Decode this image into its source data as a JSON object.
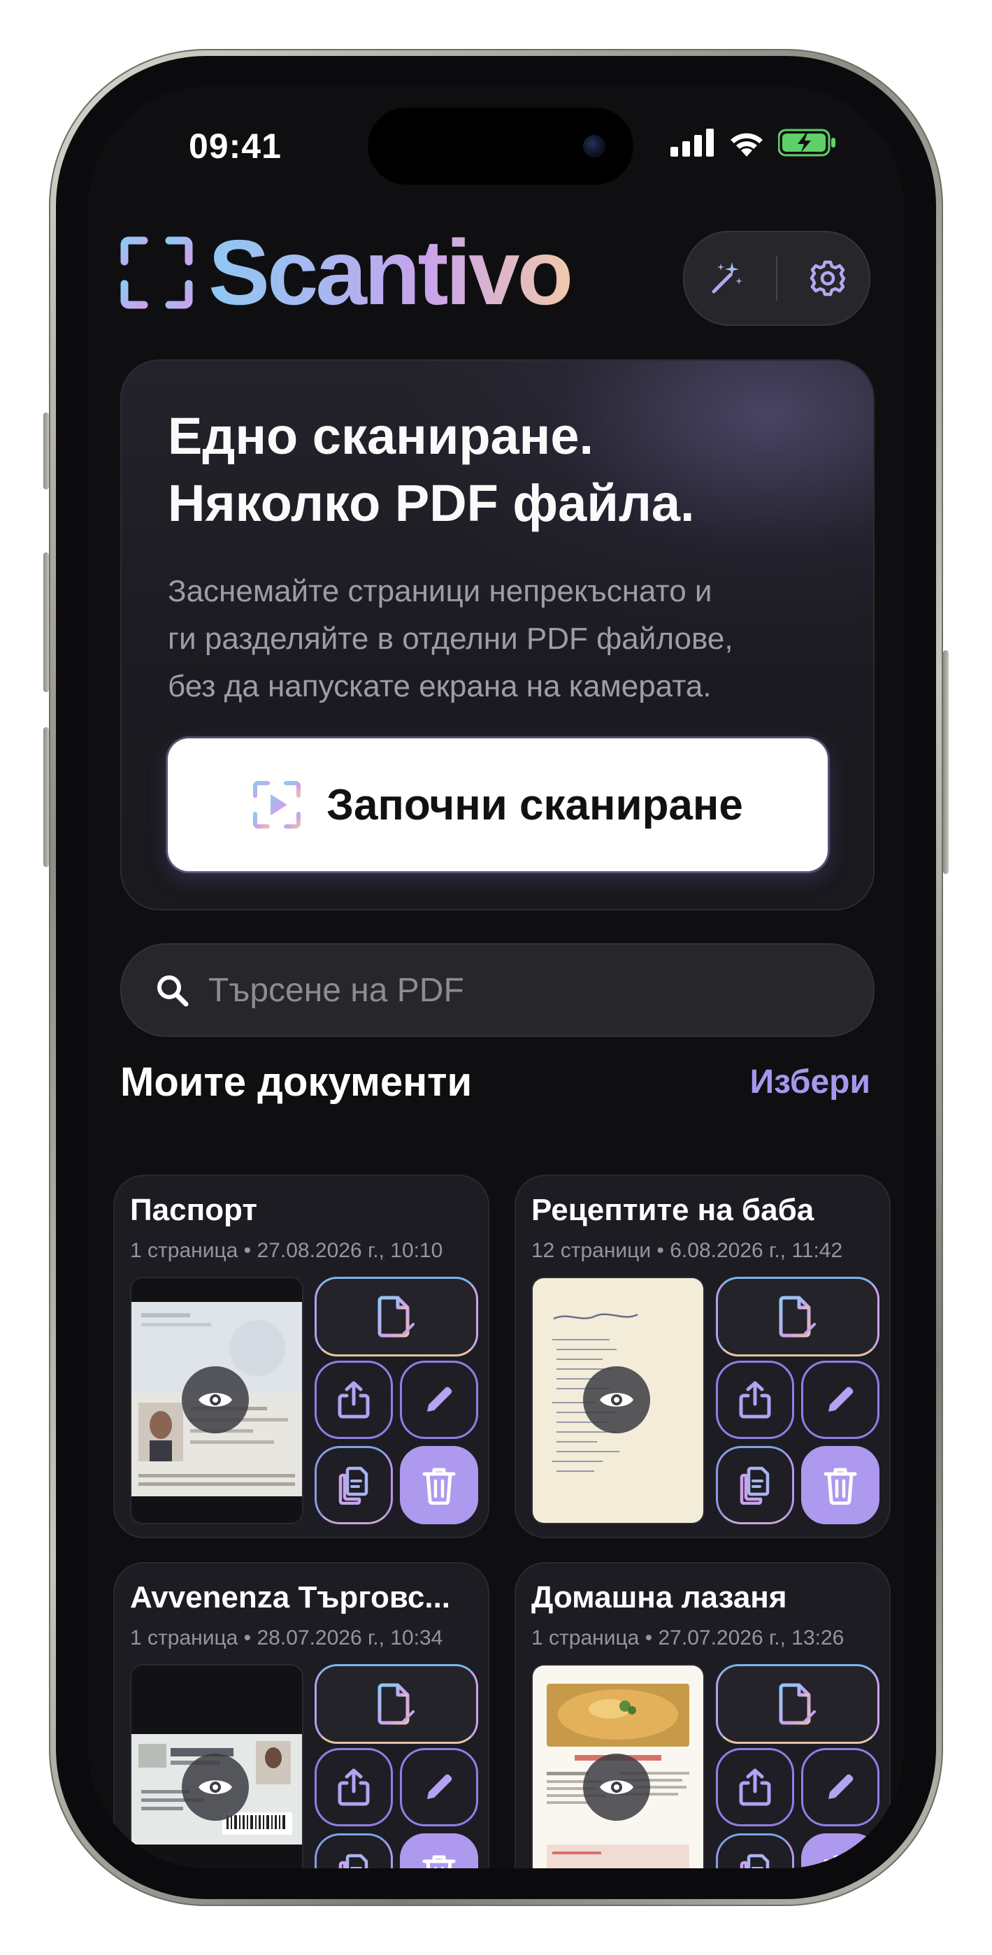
{
  "status_bar": {
    "time": "09:41"
  },
  "app": {
    "name": "Scantivo"
  },
  "hero": {
    "title_lines": [
      "Едно сканиране.",
      "Няколко PDF файла."
    ],
    "description_lines": [
      "Заснемайте страници непрекъснато и",
      "ги разделяйте в отделни PDF файлове,",
      "без да напускате екрана на камерата."
    ],
    "start_button_label": "Започни сканиране"
  },
  "search": {
    "placeholder": "Търсене на PDF"
  },
  "documents_section": {
    "title": "Моите документи",
    "action_label": "Избери"
  },
  "documents": [
    {
      "name": "Паспорт",
      "meta": "1 страница • 27.08.2026 г., 10:10",
      "thumbnail": "passport"
    },
    {
      "name": "Рецептите на баба",
      "meta": "12 страници • 6.08.2026 г., 11:42",
      "thumbnail": "handwritten-recipe"
    },
    {
      "name": "Avvenenza Търговс...",
      "meta": "1 страница • 28.07.2026 г., 10:34",
      "thumbnail": "id-card"
    },
    {
      "name": "Домашна лазаня",
      "meta": "1 страница • 27.07.2026 г., 13:26",
      "thumbnail": "recipe-page"
    }
  ],
  "colors": {
    "background": "#0f0f12",
    "card": "#1d1c22",
    "accent": "#a896ee",
    "delete_button": "#ad99ee"
  },
  "icons": {
    "top_actions": [
      "magic-wand-icon",
      "gear-icon"
    ],
    "card_actions": [
      "document-edit-icon",
      "share-icon",
      "pencil-icon",
      "duplicate-icon",
      "trash-icon"
    ]
  }
}
